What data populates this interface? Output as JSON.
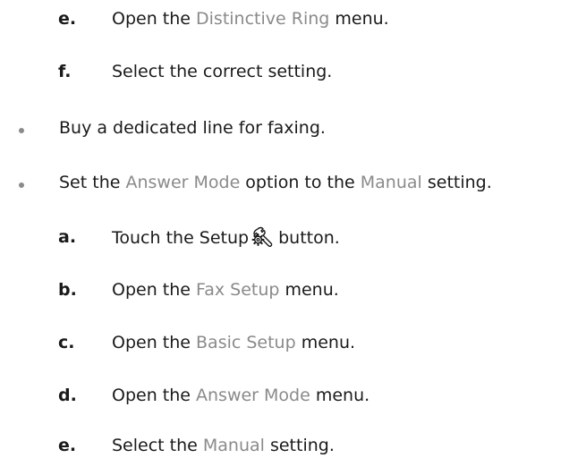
{
  "steps_top": [
    {
      "letter": "e.",
      "pre": "Open the ",
      "term": "Distinctive Ring",
      "post": " menu."
    },
    {
      "letter": "f.",
      "pre": "Select the correct setting.",
      "term": "",
      "post": ""
    }
  ],
  "bullets": [
    {
      "pre": "Buy a dedicated line for faxing.",
      "term": "",
      "mid": "",
      "term2": "",
      "post": ""
    },
    {
      "pre": "Set the ",
      "term": "Answer Mode",
      "mid": " option to the ",
      "term2": "Manual",
      "post": " setting."
    }
  ],
  "steps_bottom": {
    "a": {
      "letter": "a.",
      "pre": "Touch the Setup",
      "post": "button.",
      "icon": "setup-wrench-gear-icon"
    },
    "b": {
      "letter": "b.",
      "pre": "Open the ",
      "term": "Fax Setup",
      "post": " menu."
    },
    "c": {
      "letter": "c.",
      "pre": "Open the ",
      "term": "Basic Setup",
      "post": " menu."
    },
    "d": {
      "letter": "d.",
      "pre": "Open the ",
      "term": "Answer Mode",
      "post": " menu."
    },
    "e": {
      "letter": "e.",
      "pre": "Select the ",
      "term": "Manual",
      "post": " setting."
    }
  },
  "colors": {
    "ui_term": "#8a8a8a",
    "bullet": "#8a8a8a",
    "text": "#1a1a1a"
  }
}
